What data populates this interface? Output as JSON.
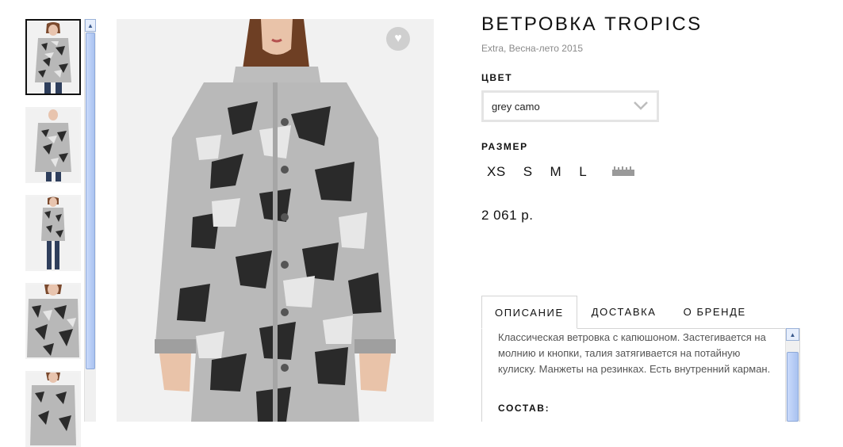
{
  "product": {
    "title": "ВЕТРОВКА TROPICS",
    "subtitle": "Extra, Весна-лето 2015",
    "price": "2 061 р."
  },
  "color": {
    "label": "ЦВЕТ",
    "selected": "grey camo"
  },
  "size": {
    "label": "РАЗМЕР",
    "options": [
      "XS",
      "S",
      "M",
      "L"
    ],
    "size_chart_icon": "ruler-icon"
  },
  "gallery": {
    "thumbnail_count": 5,
    "active_index": 0,
    "favorite_icon": "heart-icon"
  },
  "tabs": {
    "items": [
      "ОПИСАНИЕ",
      "ДОСТАВКА",
      "О БРЕНДЕ"
    ],
    "active_index": 0
  },
  "description": {
    "text": "Классическая ветровка с капюшоном. Застегивается на молнию и кнопки, талия затягивается на потайную кулиску. Манжеты на резинках. Есть внутренний карман.",
    "composition_label": "СОСТАВ:"
  },
  "colors": {
    "accent": "#111111",
    "muted_text": "#8a8a8a",
    "scrollbar": "#a9c2f0"
  }
}
